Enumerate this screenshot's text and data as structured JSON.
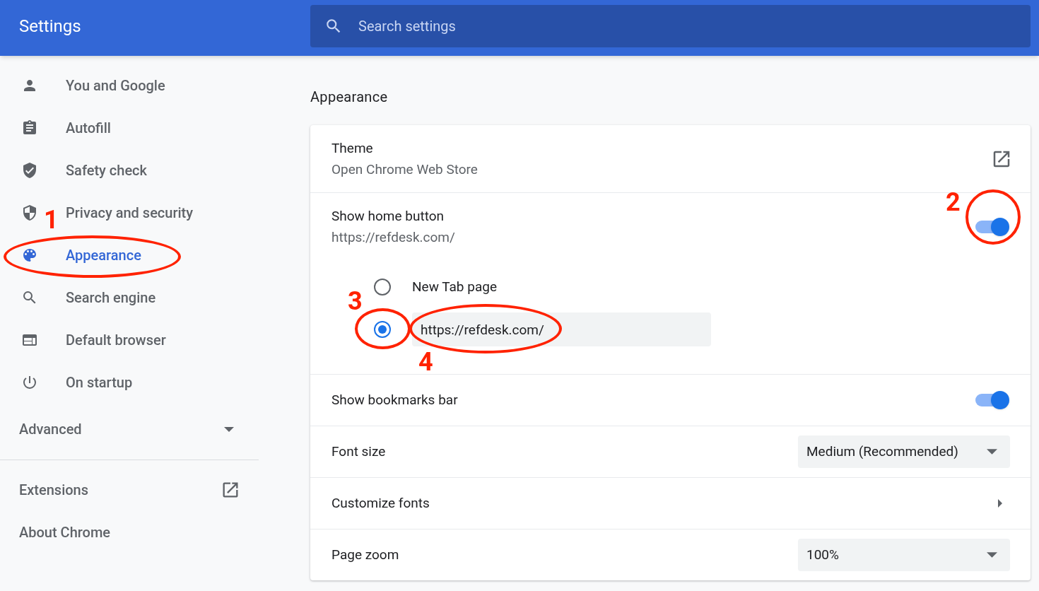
{
  "header": {
    "title": "Settings",
    "search": {
      "placeholder": "Search settings"
    }
  },
  "sidebar": {
    "items": [
      {
        "label": "You and Google",
        "selected": false
      },
      {
        "label": "Autofill",
        "selected": false
      },
      {
        "label": "Safety check",
        "selected": false
      },
      {
        "label": "Privacy and security",
        "selected": false
      },
      {
        "label": "Appearance",
        "selected": true,
        "annotation": "1"
      },
      {
        "label": "Search engine",
        "selected": false
      },
      {
        "label": "Default browser",
        "selected": false
      },
      {
        "label": "On startup",
        "selected": false
      }
    ],
    "advanced": {
      "label": "Advanced",
      "expanded": false
    },
    "links": [
      {
        "label": "Extensions",
        "external": true
      },
      {
        "label": "About Chrome",
        "external": false
      }
    ]
  },
  "section": {
    "title": "Appearance",
    "rows": [
      {
        "kind": "link",
        "label": "Theme",
        "sublabel": "Open Chrome Web Store"
      },
      {
        "kind": "toggle",
        "label": "Show home button",
        "sublabel": "https://refdesk.com/",
        "on": true,
        "annotation": "2",
        "options": [
          {
            "label": "New Tab page",
            "selected": false
          },
          {
            "value": "https://refdesk.com/",
            "selected": true,
            "radio_annotation": "3",
            "field_annotation": "4"
          }
        ]
      },
      {
        "kind": "toggle",
        "label": "Show bookmarks bar",
        "on": true
      },
      {
        "kind": "select",
        "label": "Font size",
        "value": "Medium (Recommended)"
      },
      {
        "kind": "arrow",
        "label": "Customize fonts"
      },
      {
        "kind": "select",
        "label": "Page zoom",
        "value": "100%"
      }
    ]
  }
}
